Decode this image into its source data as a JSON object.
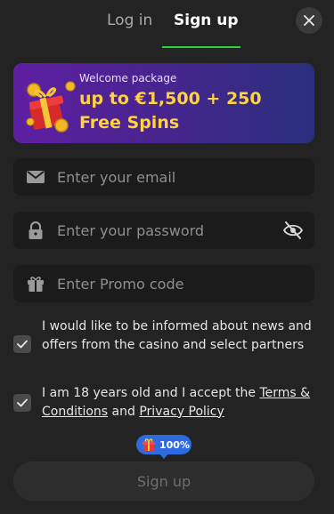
{
  "tabs": [
    {
      "label": "Log in"
    },
    {
      "label": "Sign up"
    }
  ],
  "accent_color": "#2bd43f",
  "banner": {
    "subtitle": "Welcome package",
    "title": "up to €1,500 + 250 Free Spins",
    "title_color": "#ffd23f"
  },
  "fields": {
    "email": {
      "placeholder": "Enter your email",
      "value": ""
    },
    "password": {
      "placeholder": "Enter your password",
      "value": ""
    },
    "promo": {
      "placeholder": "Enter Promo code",
      "value": ""
    }
  },
  "consents": {
    "news": {
      "checked": true,
      "text": "I would like to be informed about news and offers from the casino and select partners"
    },
    "age": {
      "checked": true,
      "text_prefix": "I am 18 years old and I accept the ",
      "terms_link": "Terms & Conditions",
      "text_and": " and ",
      "privacy_link": "Privacy Policy"
    }
  },
  "progress": {
    "label": "100%",
    "percent": 100
  },
  "submit_label": "Sign up",
  "icons": [
    "close-icon",
    "email-icon",
    "lock-icon",
    "eye-off-icon",
    "gift-icon",
    "checkmark-icon",
    "gift-box-icon"
  ]
}
